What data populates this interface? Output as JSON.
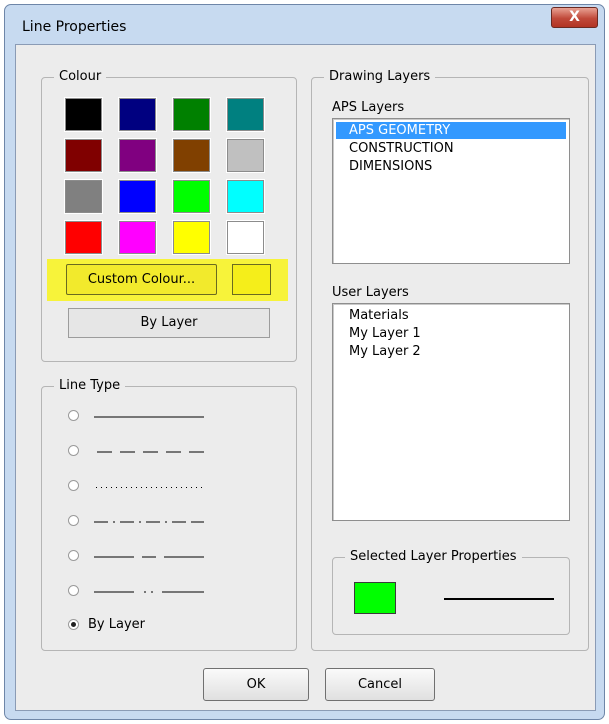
{
  "window": {
    "title": "Line Properties",
    "close_glyph": "X"
  },
  "colour": {
    "group_label": "Colour",
    "swatches": [
      "#000000",
      "#000080",
      "#008000",
      "#008080",
      "#800000",
      "#800080",
      "#804000",
      "#c0c0c0",
      "#808080",
      "#0000ff",
      "#00ff00",
      "#00ffff",
      "#ff0000",
      "#ff00ff",
      "#ffff00",
      "#ffffff"
    ],
    "custom_button_label": "Custom Colour...",
    "custom_swatch_color": "#f5ee1a",
    "highlight_color": "#f7f33a",
    "by_layer_label": "By Layer"
  },
  "line_type": {
    "group_label": "Line Type",
    "options": [
      {
        "style": "solid",
        "checked": false
      },
      {
        "style": "dashed",
        "checked": false
      },
      {
        "style": "dotted",
        "checked": false
      },
      {
        "style": "dash-dot",
        "checked": false
      },
      {
        "style": "long-dash",
        "checked": false
      },
      {
        "style": "dash-dot-dot",
        "checked": false
      }
    ],
    "by_layer_label": "By Layer",
    "by_layer_checked": true
  },
  "drawing_layers": {
    "group_label": "Drawing Layers",
    "aps_label": "APS Layers",
    "aps_items": [
      "APS GEOMETRY",
      "CONSTRUCTION",
      "DIMENSIONS"
    ],
    "aps_selected_index": 0,
    "user_label": "User Layers",
    "user_items": [
      "Materials",
      "My Layer 1",
      "My Layer 2"
    ],
    "selected_props_label": "Selected Layer Properties",
    "selected_color": "#00ff00",
    "selection_color": "#3399ff"
  },
  "buttons": {
    "ok": "OK",
    "cancel": "Cancel"
  }
}
